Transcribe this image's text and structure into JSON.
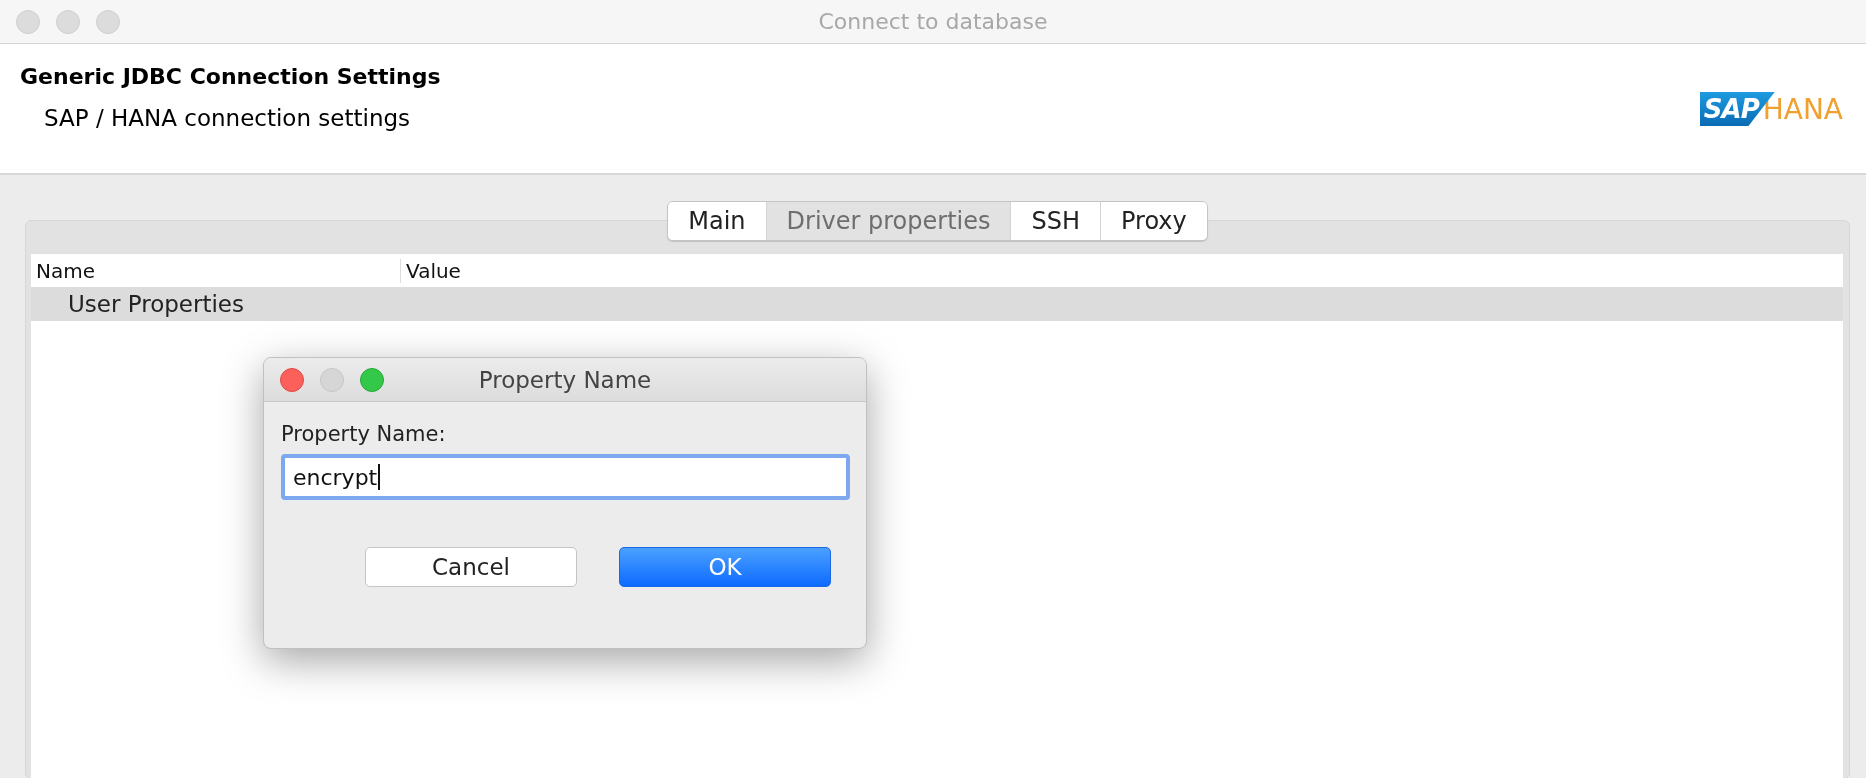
{
  "window": {
    "title": "Connect to database"
  },
  "header": {
    "title": "Generic JDBC Connection Settings",
    "subtitle": "SAP / HANA connection settings",
    "logo": {
      "mark": "SAP",
      "product": "HANA"
    }
  },
  "tabs": [
    {
      "label": "Main",
      "selected": false
    },
    {
      "label": "Driver properties",
      "selected": true
    },
    {
      "label": "SSH",
      "selected": false
    },
    {
      "label": "Proxy",
      "selected": false
    }
  ],
  "table": {
    "columns": [
      "Name",
      "Value"
    ],
    "groups": [
      {
        "label": "User Properties"
      }
    ]
  },
  "dialog": {
    "title": "Property Name",
    "field": {
      "label": "Property Name:",
      "value": "encrypt"
    },
    "buttons": [
      {
        "label": "Cancel",
        "kind": "secondary"
      },
      {
        "label": "OK",
        "kind": "primary"
      }
    ]
  }
}
